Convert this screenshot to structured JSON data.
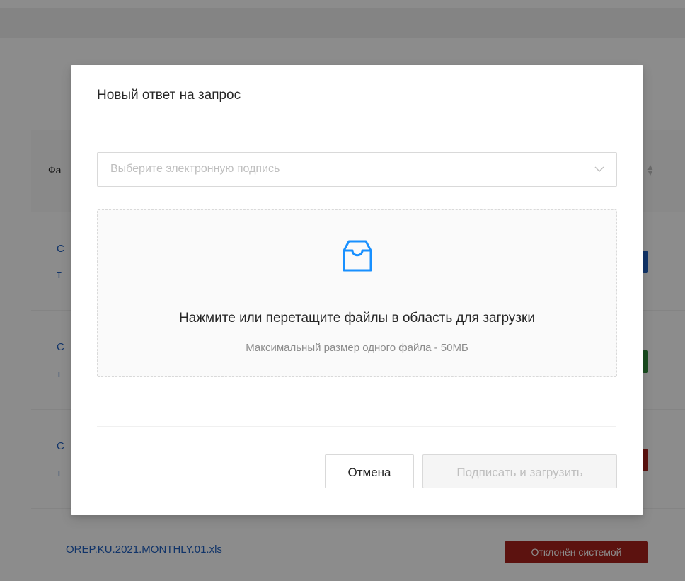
{
  "background": {
    "table_header_label_fragment": "Фа",
    "rows": [
      {
        "line1": "С",
        "line2": "т",
        "status_color": "#1f5fbf"
      },
      {
        "line1": "С",
        "line2": "т",
        "status_color": "#2e8b3a"
      },
      {
        "line1": "С",
        "line2": "т",
        "status_color": "#a8221c"
      }
    ],
    "last_row": {
      "file_name": "OREP.KU.2021.MONTHLY.01.xls",
      "status": "Отклонён системой",
      "status_color": "#a8221c"
    }
  },
  "modal": {
    "title": "Новый ответ на запрос",
    "signature_select": {
      "placeholder": "Выберите электронную подпись"
    },
    "upload": {
      "icon": "inbox-icon",
      "text": "Нажмите или перетащите файлы в область для загрузки",
      "hint": "Максимальный размер одного файла - 50МБ"
    },
    "buttons": {
      "cancel": "Отмена",
      "submit": "Подписать и загрузить"
    }
  },
  "colors": {
    "accent": "#1890ff",
    "link": "#1f5fbf",
    "rejected": "#a8221c"
  }
}
